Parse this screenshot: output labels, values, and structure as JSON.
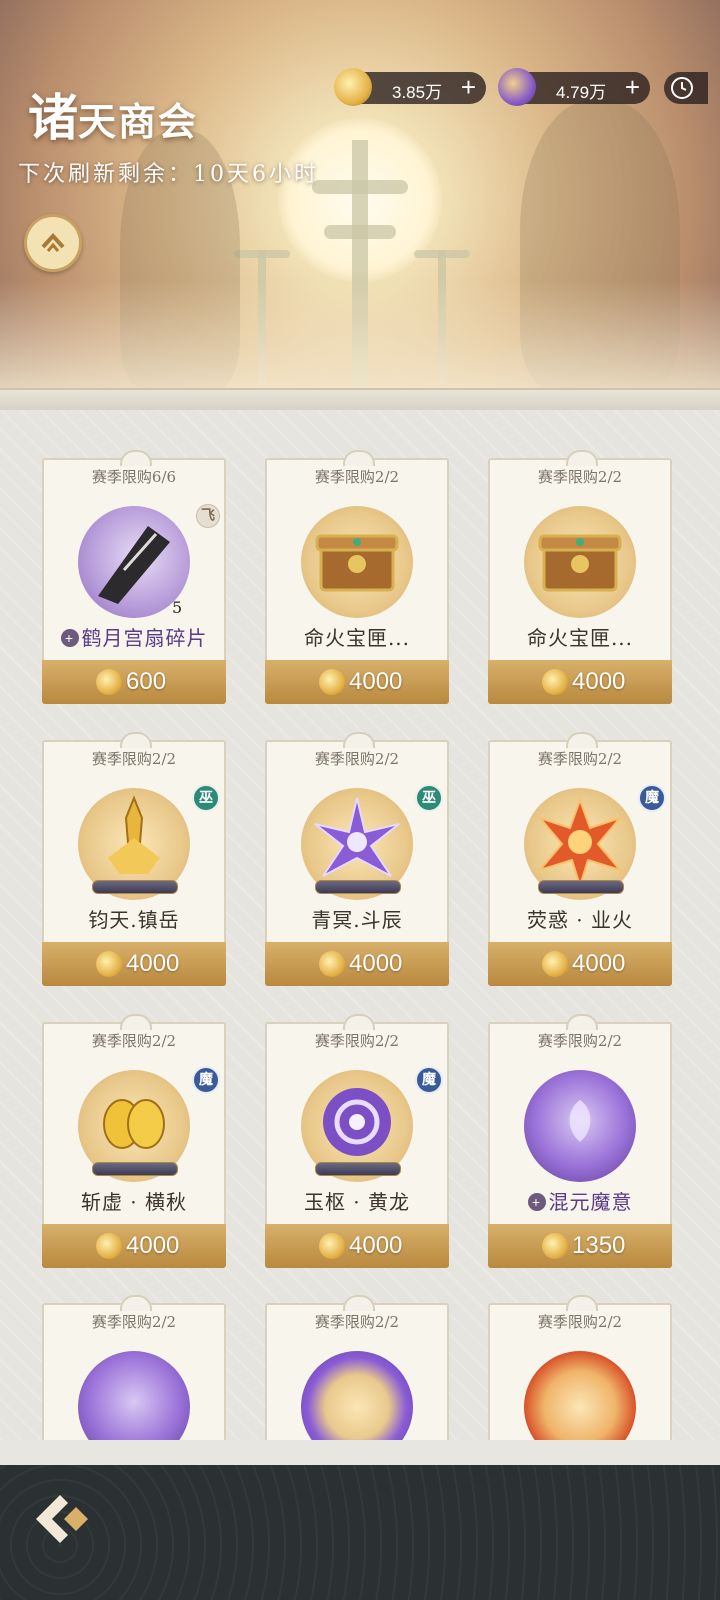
{
  "header": {
    "title_first": "诸",
    "title_rest": "天商会",
    "refresh_label": "下次刷新剩余：",
    "refresh_time": "10天6小时"
  },
  "currency": [
    {
      "name": "coin-currency",
      "value": "3.85万",
      "icon": "gold-coin-icon",
      "color": "#e5b44a"
    },
    {
      "name": "ticket-currency",
      "value": "4.79万",
      "icon": "purple-ticket-icon",
      "color": "#8a5cc7"
    }
  ],
  "cards": [
    {
      "limit": "赛季限购6/6",
      "name": "鹤月宫扇碎片",
      "price": "600",
      "count": "5",
      "badge": "飞",
      "icon": "fan-fragment-icon",
      "name_style": "purple",
      "plus": true
    },
    {
      "limit": "赛季限购2/2",
      "name": "命火宝匣...",
      "price": "4000",
      "badge": "",
      "icon": "treasure-chest-icon"
    },
    {
      "limit": "赛季限购2/2",
      "name": "命火宝匣...",
      "price": "4000",
      "badge": "",
      "icon": "treasure-chest-icon"
    },
    {
      "limit": "赛季限购2/2",
      "name": "钧天.镇岳",
      "price": "4000",
      "badge": "巫",
      "icon": "golden-sword-scroll-icon"
    },
    {
      "limit": "赛季限购2/2",
      "name": "青冥.斗辰",
      "price": "4000",
      "badge": "巫",
      "icon": "purple-star-scroll-icon"
    },
    {
      "limit": "赛季限购2/2",
      "name": "荧惑 · 业火",
      "price": "4000",
      "badge": "魔",
      "icon": "fire-burst-scroll-icon"
    },
    {
      "limit": "赛季限购2/2",
      "name": "斩虚 · 横秋",
      "price": "4000",
      "badge": "魔",
      "icon": "golden-seed-scroll-icon"
    },
    {
      "limit": "赛季限购2/2",
      "name": "玉枢 · 黄龙",
      "price": "4000",
      "badge": "魔",
      "icon": "vortex-scroll-icon"
    },
    {
      "limit": "赛季限购2/2",
      "name": "混元魔意",
      "price": "1350",
      "badge": "",
      "icon": "purple-lotus-orb-icon",
      "plus": true
    },
    {
      "limit": "赛季限购2/2",
      "name": "",
      "price": "",
      "badge": "",
      "icon": "purple-butterfly-orb-icon"
    },
    {
      "limit": "赛季限购2/2",
      "name": "",
      "price": "",
      "badge": "",
      "icon": "purple-lotus-orb-icon"
    },
    {
      "limit": "赛季限购2/2",
      "name": "",
      "price": "",
      "badge": "",
      "icon": "red-flame-orb-icon"
    }
  ]
}
